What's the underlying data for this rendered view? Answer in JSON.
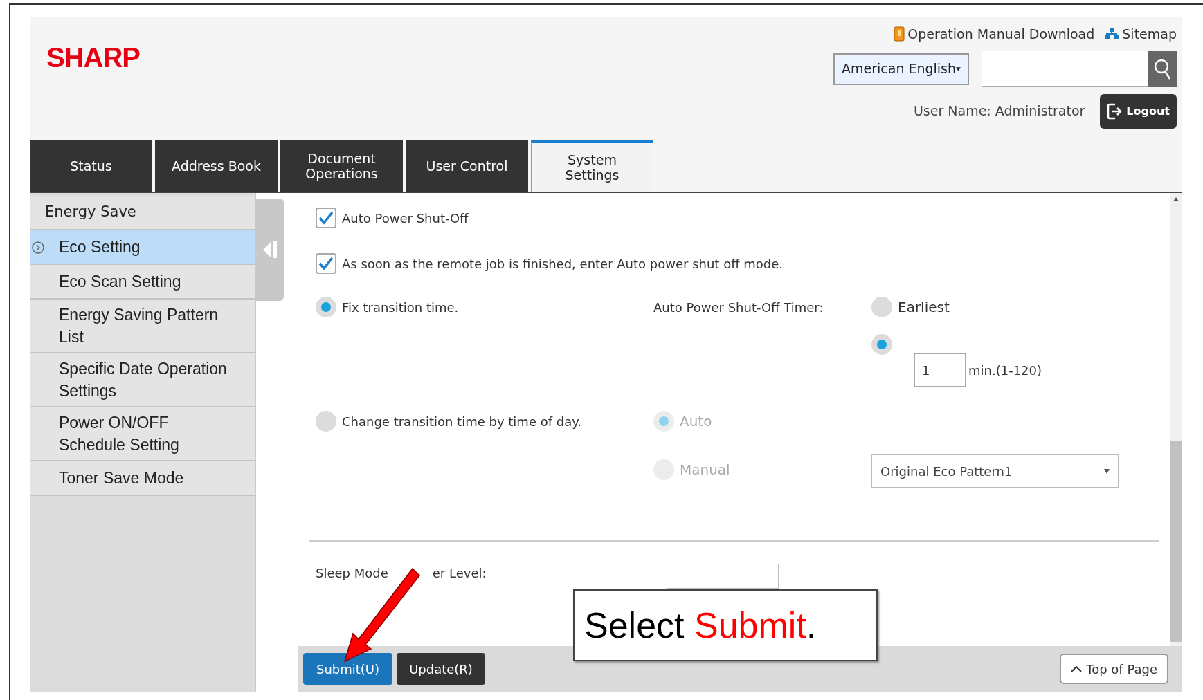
{
  "header": {
    "logo": "SHARP",
    "links": [
      {
        "kind": "manual",
        "label": "Operation Manual Download"
      },
      {
        "kind": "sitemap",
        "label": "Sitemap"
      }
    ],
    "language": "American English",
    "user_name": "User Name: Administrator",
    "logout": "Logout"
  },
  "tabs": [
    {
      "label": "Status",
      "selected": false
    },
    {
      "label": "Address Book",
      "selected": false
    },
    {
      "label": "Document\nOperations",
      "selected": false
    },
    {
      "label": "User Control",
      "selected": false
    },
    {
      "label": "System\nSettings",
      "selected": true
    }
  ],
  "sidebar": {
    "heading": "Energy Save",
    "items": [
      {
        "label": "Eco Setting",
        "selected": true
      },
      {
        "label": "Eco Scan Setting",
        "selected": false
      },
      {
        "label": "Energy Saving Pattern List",
        "selected": false
      },
      {
        "label": "Specific Date Operation Settings",
        "selected": false
      },
      {
        "label": "Power ON/OFF Schedule Setting",
        "selected": false
      },
      {
        "label": "Toner Save Mode",
        "selected": false
      }
    ]
  },
  "checkboxes": [
    {
      "label": "Auto Power Shut-Off",
      "checked": true
    },
    {
      "label": "As soon as the remote job is finished, enter Auto power shut off mode.",
      "checked": true
    }
  ],
  "transition_options": [
    {
      "label": "Fix transition time.",
      "selected": true
    },
    {
      "label": "Change transition time by time of day.",
      "selected": false
    }
  ],
  "timer": {
    "label": "Auto Power Shut-Off Timer:",
    "options": [
      {
        "kind": "preset",
        "label": "Earliest",
        "selected": false
      },
      {
        "kind": "minutes",
        "value": "1",
        "unit": "min.(1-120)",
        "selected": true
      }
    ]
  },
  "time_of_day": {
    "options": [
      {
        "label": "Auto",
        "selected": true,
        "disabled": true
      },
      {
        "label": "Manual",
        "selected": false,
        "disabled": true
      }
    ],
    "pattern": "Original Eco Pattern1"
  },
  "sleep_label_parts": [
    "Sleep Mode",
    "er Level:"
  ],
  "buttons": {
    "submit": "Submit(U)",
    "update": "Update(R)",
    "top": "Top of Page"
  },
  "callout": [
    {
      "kind": "plain",
      "text": "Select "
    },
    {
      "kind": "highlight",
      "text": "Submit"
    },
    {
      "kind": "plain",
      "text": "."
    }
  ]
}
